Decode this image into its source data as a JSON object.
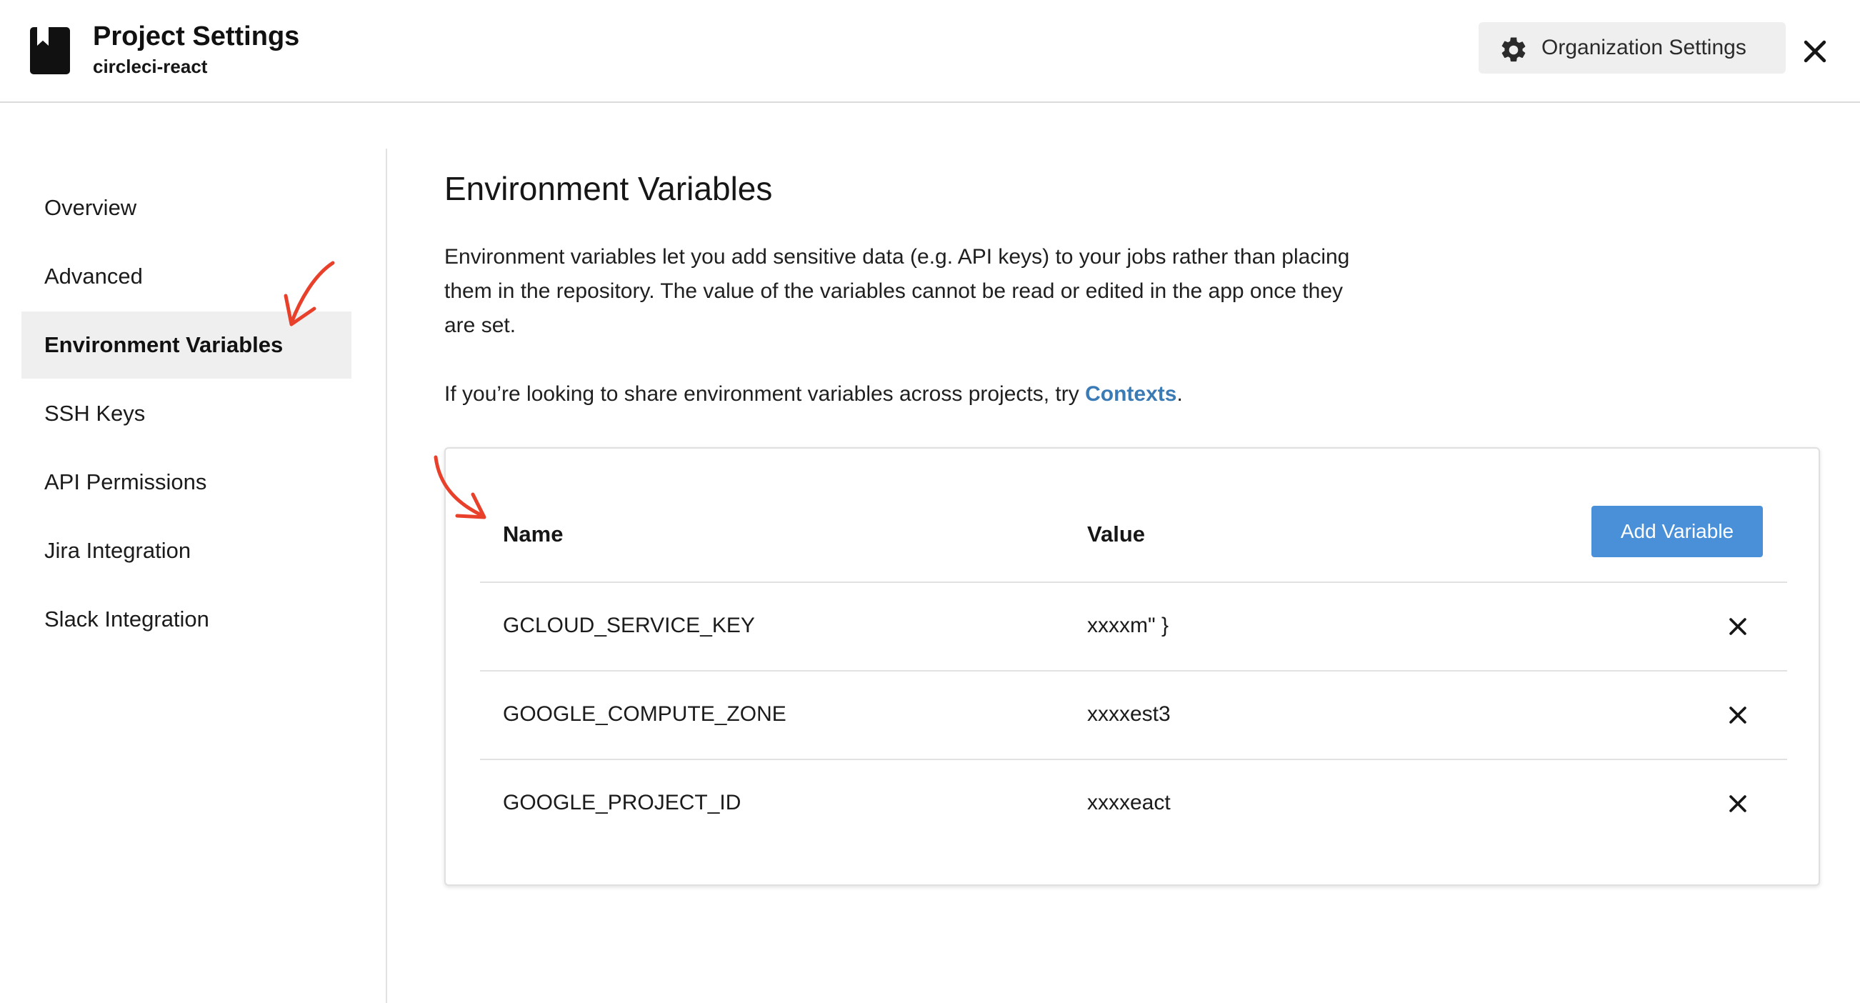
{
  "header": {
    "title": "Project Settings",
    "project_name": "circleci-react",
    "project_icon": "bookmark-icon",
    "org_settings_label": "Organization Settings",
    "org_settings_icon": "gear-icon",
    "close_icon": "close-icon"
  },
  "sidebar": {
    "items": [
      {
        "label": "Overview",
        "active": false
      },
      {
        "label": "Advanced",
        "active": false
      },
      {
        "label": "Environment Variables",
        "active": true
      },
      {
        "label": "SSH Keys",
        "active": false
      },
      {
        "label": "API Permissions",
        "active": false
      },
      {
        "label": "Jira Integration",
        "active": false
      },
      {
        "label": "Slack Integration",
        "active": false
      }
    ]
  },
  "main": {
    "title": "Environment Variables",
    "description": "Environment variables let you add sensitive data (e.g. API keys) to your jobs rather than placing them in the repository. The value of the variables cannot be read or edited in the app once they are set.",
    "contexts_prefix": "If you’re looking to share environment variables across projects, try ",
    "contexts_link": "Contexts",
    "contexts_suffix": "."
  },
  "table": {
    "columns": {
      "name": "Name",
      "value": "Value"
    },
    "add_button_label": "Add Variable",
    "rows": [
      {
        "name": "GCLOUD_SERVICE_KEY",
        "value": "xxxxm\" }"
      },
      {
        "name": "GOOGLE_COMPUTE_ZONE",
        "value": "xxxxest3"
      },
      {
        "name": "GOOGLE_PROJECT_ID",
        "value": "xxxxeact"
      }
    ],
    "delete_icon": "close-icon"
  },
  "colors": {
    "accent_button": "#4a90d9",
    "link": "#3a7ab5",
    "active_nav_bg": "#efefef",
    "annotation_arrow": "#e8402a"
  }
}
